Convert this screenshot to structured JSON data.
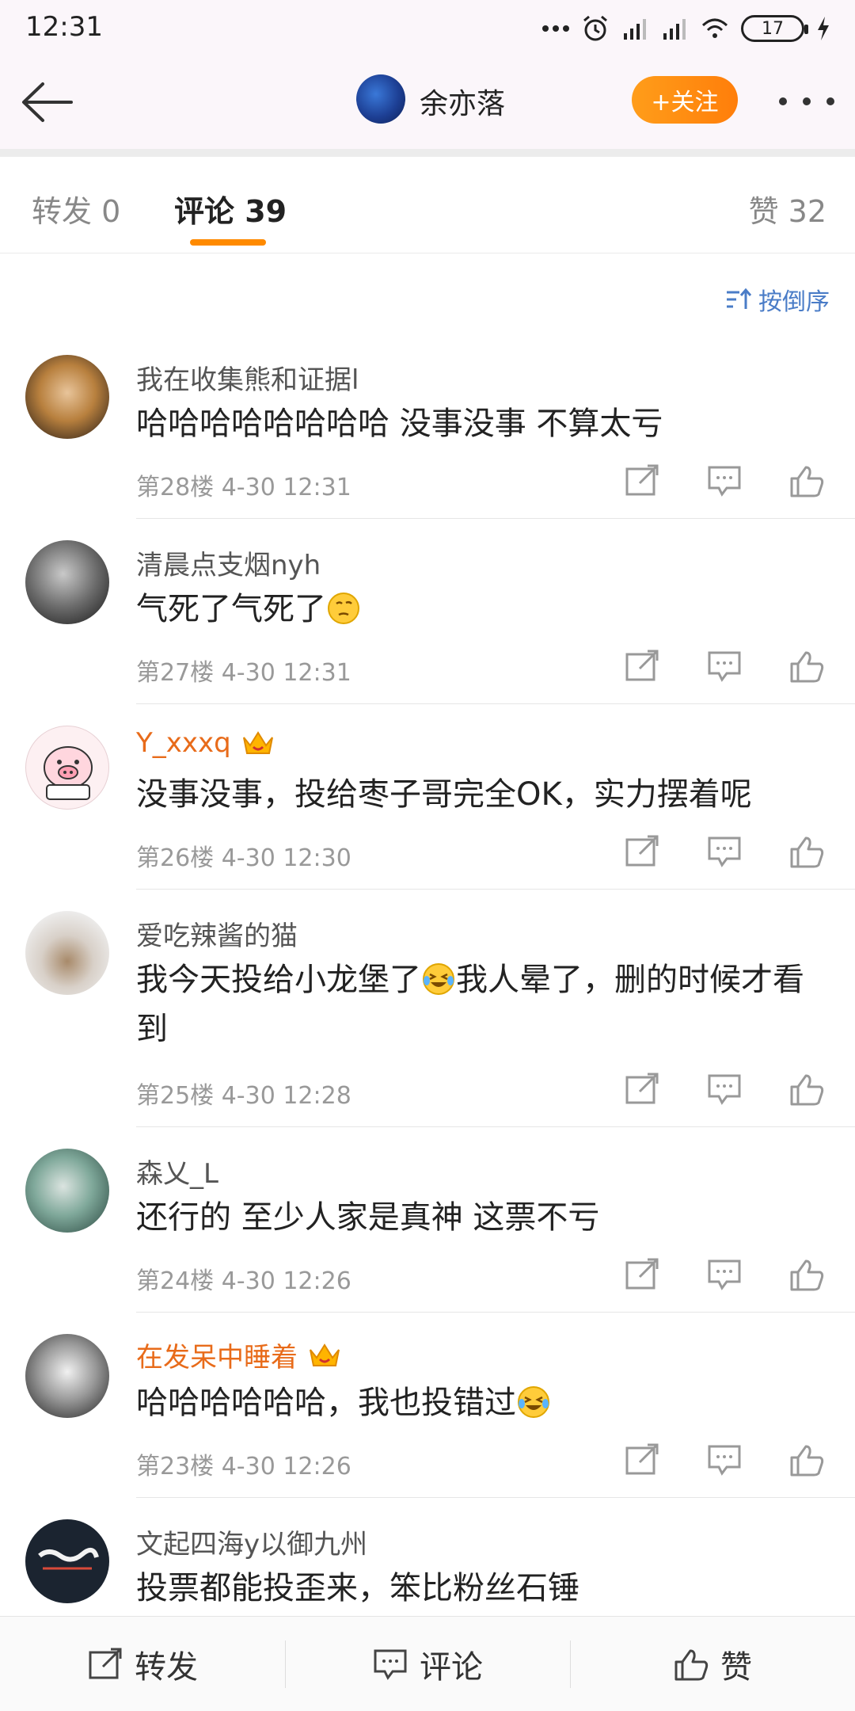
{
  "status_bar": {
    "time": "12:31",
    "battery": "17"
  },
  "header": {
    "user_name": "余亦落",
    "follow_label": "+关注"
  },
  "tabs": {
    "repost": "转发 0",
    "comments": "评论 39",
    "likes": "赞 32"
  },
  "sort_label": "按倒序",
  "comments": [
    {
      "name": "我在收集熊和证据l",
      "text": "哈哈哈哈哈哈哈哈 没事没事 不算太亏",
      "meta": "第28楼  4-30 12:31",
      "vip": false
    },
    {
      "name": "清晨点支烟nyh",
      "text": "气死了气死了",
      "meta": "第27楼  4-30 12:31",
      "vip": false
    },
    {
      "name": "Y_xxxq",
      "text": "没事没事，投给枣子哥完全OK，实力摆着呢",
      "meta": "第26楼  4-30 12:30",
      "vip": true
    },
    {
      "name": "爱吃辣酱的猫",
      "text": "我今天投给小龙堡了",
      "text2": "我人晕了，删的时候才看到",
      "meta": "第25楼  4-30 12:28",
      "vip": false
    },
    {
      "name": "森乂_L",
      "text": "还行的 至少人家是真神 这票不亏",
      "meta": "第24楼  4-30 12:26",
      "vip": false
    },
    {
      "name": "在发呆中睡着",
      "text": "哈哈哈哈哈哈，我也投错过",
      "meta": "第23楼  4-30 12:26",
      "vip": true
    },
    {
      "name": "文起四海y以御九州",
      "text": "投票都能投歪来，笨比粉丝石锤",
      "meta": "",
      "vip": false
    }
  ],
  "bottom_bar": {
    "repost": "转发",
    "comment": "评论",
    "like": "赞"
  },
  "icons": [
    "back-arrow-icon",
    "more-icon",
    "sort-icon",
    "share-icon",
    "comment-icon",
    "like-icon",
    "crown-icon",
    "emoji-icon"
  ],
  "colors": {
    "accent": "#ff8a00",
    "vip_name": "#e86b1a",
    "link": "#4a7cc7"
  }
}
